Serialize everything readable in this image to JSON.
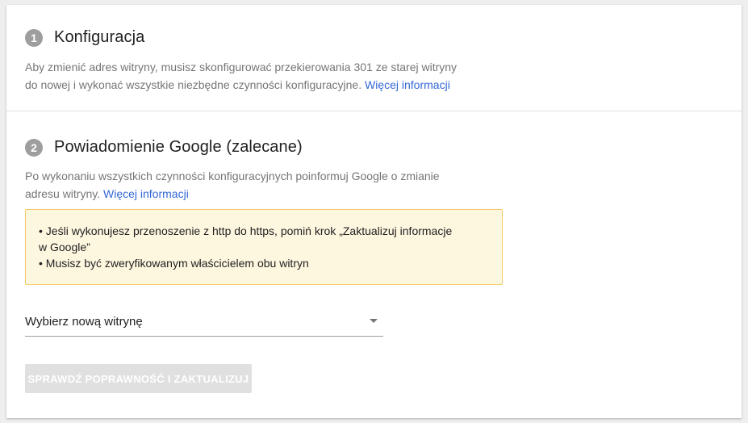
{
  "step1": {
    "number": "1",
    "title": "Konfiguracja",
    "desc_line1": "Aby zmienić adres witryny, musisz skonfigurować przekierowania 301 ze starej witryny",
    "desc_line2": "do nowej i wykonać wszystkie niezbędne czynności konfiguracyjne.",
    "link_label": "Więcej informacji"
  },
  "step2": {
    "number": "2",
    "title": "Powiadomienie Google (zalecane)",
    "desc_line1": "Po wykonaniu wszystkich czynności konfiguracyjnych poinformuj Google o zmianie",
    "desc_line2": "adresu witryny.",
    "link_label": "Więcej informacji",
    "notice": {
      "item1_line1": "• Jeśli wykonujesz przenoszenie z http do https, pomiń krok „Zaktualizuj informacje",
      "item1_line2": "w Google”",
      "item2": "• Musisz być zweryfikowanym właścicielem obu witryn"
    },
    "select_label": "Wybierz nową witrynę",
    "button_label": "SPRAWDŹ POPRAWNOŚĆ I ZAKTUALIZUJ"
  },
  "colors": {
    "link": "#3367d6",
    "step_badge": "#9e9e9e",
    "notice_bg": "#fef7e0",
    "notice_border": "#f5c96a",
    "button_disabled": "#e0e0e0"
  },
  "icons": {
    "select_caret": "caret-down-icon"
  }
}
